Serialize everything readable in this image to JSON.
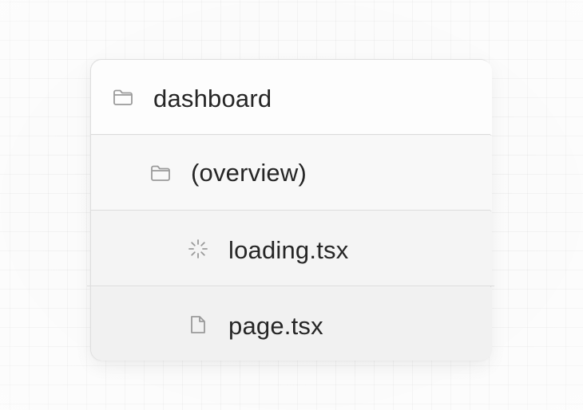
{
  "tree": {
    "items": [
      {
        "label": "dashboard",
        "icon": "folder-icon",
        "depth": 0
      },
      {
        "label": "(overview)",
        "icon": "folder-icon",
        "depth": 1
      },
      {
        "label": "loading.tsx",
        "icon": "spinner-icon",
        "depth": 2
      },
      {
        "label": "page.tsx",
        "icon": "file-icon",
        "depth": 2
      }
    ]
  },
  "colors": {
    "text": "#262626",
    "icon": "#9a9a9a",
    "border": "#dcdcdc",
    "background": "#fafafa"
  }
}
